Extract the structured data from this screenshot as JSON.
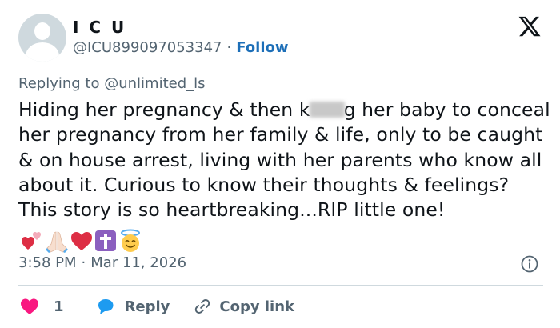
{
  "author": {
    "display_name": "I C U",
    "handle": "@ICU899097053347",
    "separator": "·",
    "follow_label": "Follow"
  },
  "reply_context": {
    "prefix": "Replying to",
    "mention": "@unlimited_ls"
  },
  "tweet": {
    "text_before_redaction": "Hiding her pregnancy & then k",
    "text_after_redaction": "g her baby to conceal her pregnancy from her family & life, only to be caught & on house arrest, living with her parents who know all about it.  Curious to know their thoughts & feelings? This story is so heartbreaking...RIP little one!",
    "emojis": [
      "two-hearts-icon",
      "folded-hands-icon",
      "red-heart-icon",
      "latin-cross-icon",
      "smiling-face-with-halo-icon"
    ]
  },
  "timestamp": {
    "time": "3:58 PM",
    "separator": "·",
    "date": "Mar 11, 2026"
  },
  "actions": {
    "like_count": "1",
    "reply_label": "Reply",
    "copy_link_label": "Copy link"
  },
  "colors": {
    "follow": "#1d6fb8",
    "secondary_text": "#536471",
    "like": "#f91880",
    "reply": "#1d9bf0",
    "divider": "#cfd9de"
  }
}
